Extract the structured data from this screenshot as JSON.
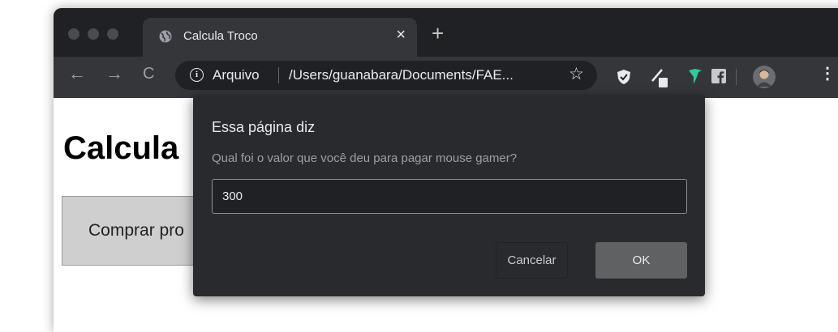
{
  "tab": {
    "title": "Calcula Troco",
    "close_icon": "×",
    "new_tab_icon": "+"
  },
  "toolbar": {
    "back_icon": "←",
    "forward_icon": "→",
    "reload_icon": "C",
    "info_icon": "i",
    "security_label": "Arquivo",
    "url": "/Users/guanabara/Documents/FAE...",
    "bookmark_icon": "☆",
    "menu_icon": "⋮"
  },
  "page": {
    "heading": "Calcula",
    "button_label": "Comprar pro"
  },
  "dialog": {
    "title": "Essa página diz",
    "message": "Qual foi o valor que você deu para pagar mouse gamer?",
    "input_value": "300",
    "cancel_label": "Cancelar",
    "ok_label": "OK"
  },
  "colors": {
    "chrome_dark": "#202124",
    "chrome_toolbar": "#35363a",
    "dialog_bg": "#292a2d",
    "ok_button": "#5f6163",
    "extension_green": "#2ecc9a"
  }
}
